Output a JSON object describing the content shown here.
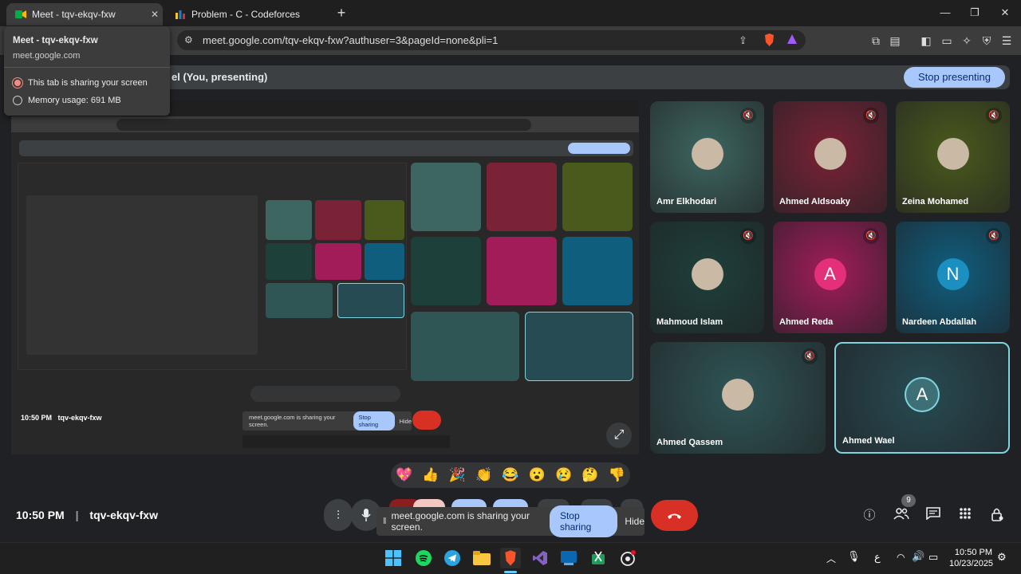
{
  "browser": {
    "active_tab_title": "Meet - tqv-ekqv-fxw",
    "other_tab_title": "Problem - C - Codeforces",
    "url": "meet.google.com/tqv-ekqv-fxw?authuser=3&pageId=none&pli=1"
  },
  "popup": {
    "title": "Meet - tqv-ekqv-fxw",
    "domain": "meet.google.com",
    "sharing_text": "This tab is sharing your screen",
    "memory_text": "Memory usage: 691 MB"
  },
  "meet": {
    "presenting_label": "el (You, presenting)",
    "stop_presenting": "Stop presenting",
    "participants": [
      {
        "name": "Amr Elkhodari",
        "initial": "",
        "color": "#3d6660"
      },
      {
        "name": "Ahmed Aldsoaky",
        "initial": "",
        "color": "#7a2236"
      },
      {
        "name": "Zeina Mohamed",
        "initial": "",
        "color": "#4a5a1c"
      },
      {
        "name": "Mahmoud Islam",
        "initial": "",
        "color": "#1d403b"
      },
      {
        "name": "Ahmed Reda",
        "initial": "A",
        "color": "#a21c5a"
      },
      {
        "name": "Nardeen Abdallah",
        "initial": "N",
        "color": "#0f5e7e"
      },
      {
        "name": "Ahmed Qassem",
        "initial": "",
        "color": "#2f5555"
      },
      {
        "name": "Ahmed Wael",
        "initial": "A",
        "color": "#274b52"
      }
    ],
    "reactions": [
      "💖",
      "👍",
      "🎉",
      "👏",
      "😂",
      "😮",
      "😢",
      "🤔",
      "👎"
    ],
    "time": "10:50 PM",
    "meeting_code": "tqv-ekqv-fxw",
    "share_text": "meet.google.com is sharing your screen.",
    "stop_sharing": "Stop sharing",
    "hide": "Hide",
    "people_count": "9"
  },
  "nested": {
    "time_code": "10:50 PM   tqv-ekqv-fxw",
    "share_text": "meet.google.com is sharing your screen.",
    "stop_sharing": "Stop sharing",
    "hide": "Hide"
  },
  "taskbar": {
    "clock_time": "10:50 PM",
    "clock_date": "10/23/2025",
    "lang": "ع"
  },
  "colors": {
    "accent_blue": "#a8c7fa",
    "end_call_red": "#d93025",
    "active_tile_border": "#7fd4e0"
  }
}
